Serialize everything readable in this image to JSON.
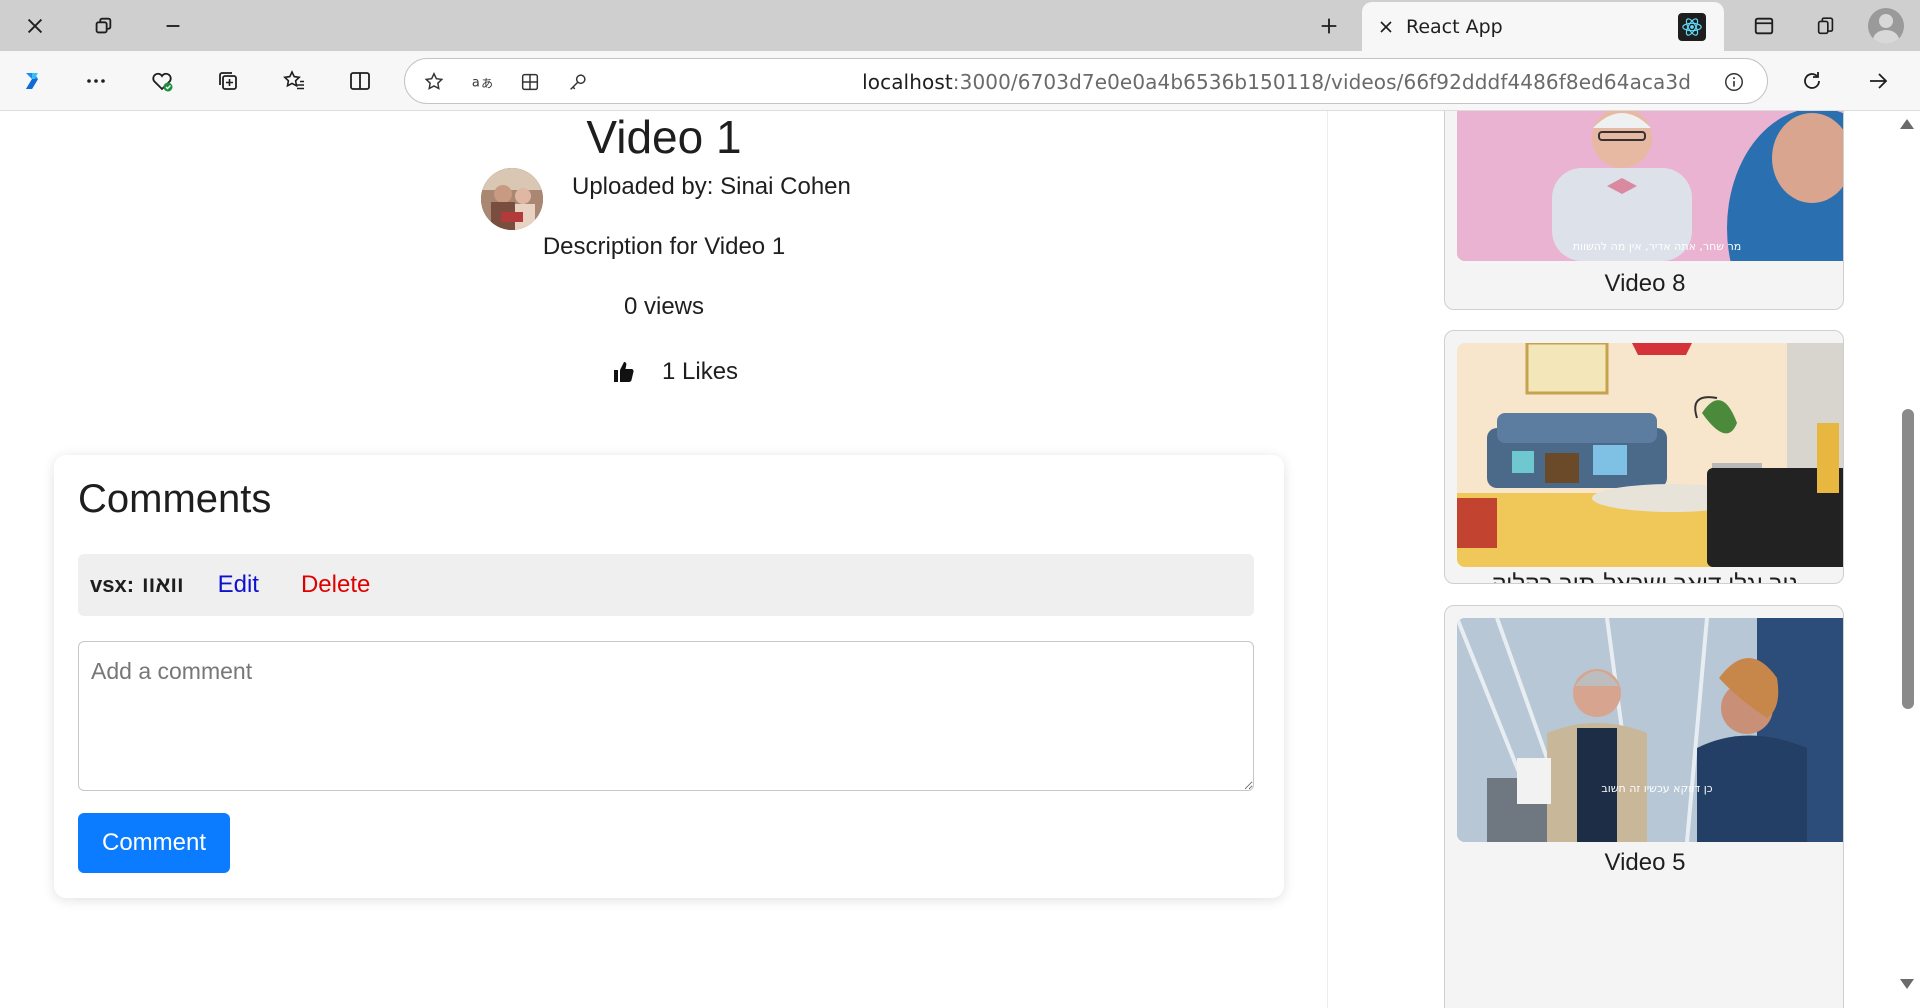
{
  "browser": {
    "tab_title": "React App",
    "url_host": "localhost",
    "url_rest": ":3000/6703d7e0e0a4b6536b150118/videos/66f92dddf4486f8ed64aca3d"
  },
  "video": {
    "title": "Video 1",
    "uploaded_by": "Uploaded by: Sinai Cohen",
    "description": "Description for Video 1",
    "views": "0 views",
    "likes": "1 Likes"
  },
  "comments": {
    "heading": "Comments",
    "items": [
      {
        "author": "vsx:",
        "text": "וואוו",
        "edit_label": "Edit",
        "delete_label": "Delete"
      }
    ],
    "input_placeholder": "Add a comment",
    "submit_label": "Comment"
  },
  "sidebar": {
    "videos": [
      {
        "title": "Video 8",
        "caption": "מר שחר, אתה אדיר, אין מה להשוות"
      },
      {
        "title": "ניר וגלי דואר ישראל-תור בקליק",
        "caption": ""
      },
      {
        "title": "Video 5",
        "caption": "כן דווקא עכשיו זה חשוב"
      }
    ]
  },
  "colors": {
    "accent": "#0b7cff",
    "edit_link": "#1010d0",
    "delete_link": "#e00000"
  }
}
